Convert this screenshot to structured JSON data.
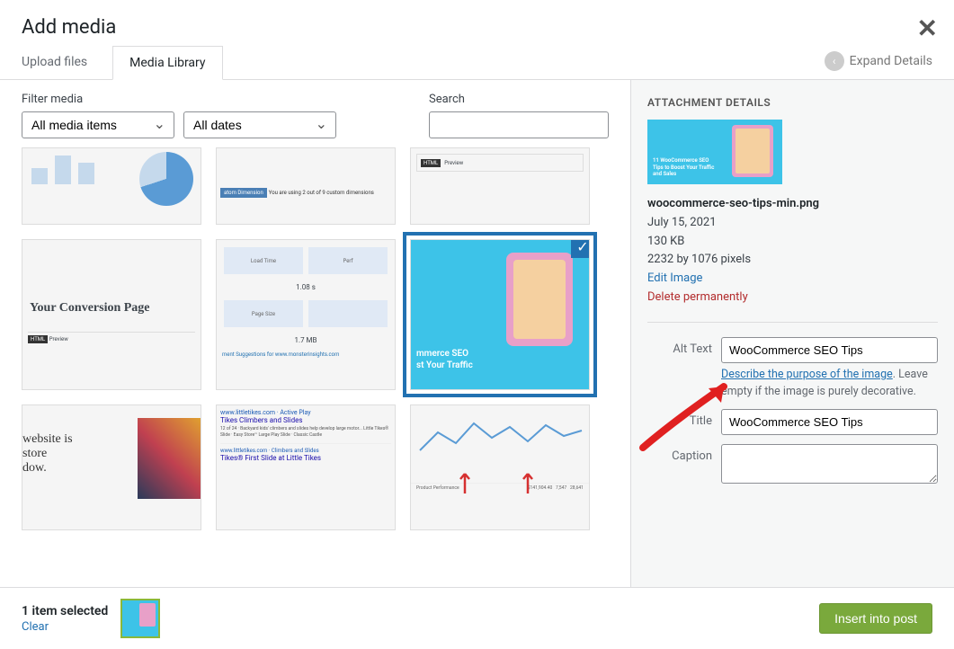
{
  "modal": {
    "title": "Add media",
    "close_label": "Close",
    "expand_details": "Expand Details"
  },
  "tabs": {
    "upload": "Upload files",
    "library": "Media Library"
  },
  "filters": {
    "filter_label": "Filter media",
    "media_items": "All media items",
    "dates": "All dates",
    "search_label": "Search",
    "search_value": ""
  },
  "selected_thumb": {
    "line1": "mmerce SEO",
    "line2": "st Your Traffic"
  },
  "details": {
    "heading": "ATTACHMENT DETAILS",
    "filename": "woocommerce-seo-tips-min.png",
    "date": "July 15, 2021",
    "size": "130 KB",
    "dimensions": "2232 by 1076 pixels",
    "edit_image": "Edit Image",
    "delete": "Delete permanently",
    "alt_label": "Alt Text",
    "alt_value": "WooCommerce SEO Tips",
    "alt_help_link": "Describe the purpose of the image",
    "alt_help_rest": ". Leave empty if the image is purely decorative.",
    "title_label": "Title",
    "title_value": "WooCommerce SEO Tips",
    "caption_label": "Caption",
    "caption_value": ""
  },
  "footer": {
    "selected_count": "1 item selected",
    "clear": "Clear",
    "insert": "Insert into post"
  },
  "thumb_texts": {
    "conversion": "Your Conversion Page",
    "website": "website is",
    "store": "store",
    "dow": "dow.",
    "load_time": "1.08 s",
    "page_size": "1.7 MB",
    "suggestions": "ment Suggestions for www.monsterinsights.com",
    "tikes1": "Tikes Climbers and Slides",
    "tikes2": "Tikes® First Slide at Little Tikes"
  }
}
